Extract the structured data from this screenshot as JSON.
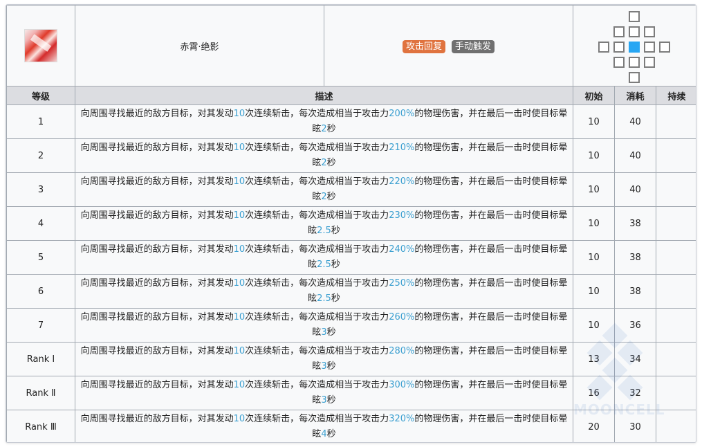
{
  "skill": {
    "icon": "skill-icon-red-slash",
    "name": "赤霄·绝影",
    "tags": [
      "攻击回复",
      "手动触发"
    ],
    "tag_colors": [
      "#e0733f",
      "#707070"
    ],
    "range_self_color": "#27a6f3"
  },
  "headers": {
    "level": "等级",
    "desc": "描述",
    "initial": "初始",
    "cost": "消耗",
    "duration": "持续"
  },
  "desc_parts": {
    "p1": "向周围寻找最近的敌方目标，对其发动",
    "p2": "次连续斩击，每次造成相当于攻击力",
    "p3": "的物理伤害，并在最后一击时使目标晕眩",
    "p4": "秒",
    "strikes": "10"
  },
  "rows": [
    {
      "level": "1",
      "pct": "200%",
      "stun": "2",
      "initial": "10",
      "cost": "40",
      "duration": ""
    },
    {
      "level": "2",
      "pct": "210%",
      "stun": "2",
      "initial": "10",
      "cost": "40",
      "duration": ""
    },
    {
      "level": "3",
      "pct": "220%",
      "stun": "2",
      "initial": "10",
      "cost": "40",
      "duration": ""
    },
    {
      "level": "4",
      "pct": "230%",
      "stun": "2.5",
      "initial": "10",
      "cost": "38",
      "duration": ""
    },
    {
      "level": "5",
      "pct": "240%",
      "stun": "2.5",
      "initial": "10",
      "cost": "38",
      "duration": ""
    },
    {
      "level": "6",
      "pct": "250%",
      "stun": "2.5",
      "initial": "10",
      "cost": "38",
      "duration": ""
    },
    {
      "level": "7",
      "pct": "260%",
      "stun": "3",
      "initial": "10",
      "cost": "36",
      "duration": ""
    },
    {
      "level": "Rank Ⅰ",
      "pct": "280%",
      "stun": "3",
      "initial": "13",
      "cost": "34",
      "duration": ""
    },
    {
      "level": "Rank Ⅱ",
      "pct": "300%",
      "stun": "3",
      "initial": "16",
      "cost": "32",
      "duration": ""
    },
    {
      "level": "Rank Ⅲ",
      "pct": "320%",
      "stun": "4",
      "initial": "20",
      "cost": "30",
      "duration": ""
    }
  ],
  "watermark": {
    "text": "MOONCELL"
  }
}
